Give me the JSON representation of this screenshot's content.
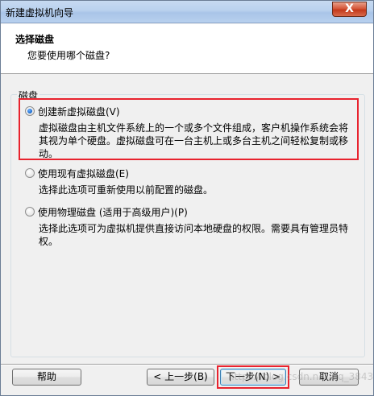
{
  "window": {
    "title": "新建虚拟机向导",
    "close_symbol": "X"
  },
  "header": {
    "title": "选择磁盘",
    "subtitle": "您要使用哪个磁盘?"
  },
  "group": {
    "label": "磁盘"
  },
  "options": [
    {
      "label": "创建新虚拟磁盘(V)",
      "checked": true,
      "description_line1": "虚拟磁盘由主机文件系统上的一个或多个文件组成，客户机操作系统会将",
      "description_line2": "其视为单个硬盘。虚拟磁盘可在一台主机上或多台主机之间轻松复制或移",
      "description_line3": "动。"
    },
    {
      "label": "使用现有虚拟磁盘(E)",
      "checked": false,
      "description_line1": "选择此选项可重新使用以前配置的磁盘。"
    },
    {
      "label": "使用物理磁盘 (适用于高级用户)(P)",
      "checked": false,
      "description_line1": "选择此选项可为虚拟机提供直接访问本地硬盘的权限。需要具有管理员特",
      "description_line2": "权。"
    }
  ],
  "buttons": {
    "help": "帮助",
    "back": "< 上一步(B)",
    "next": "下一步(N) >",
    "cancel": "取消"
  },
  "watermark": "https://blog.csdn.net/qq_38439661",
  "colors": {
    "highlight": "#e8232e",
    "titlebar": "#b9d1ee",
    "close_button": "#c3391b"
  }
}
